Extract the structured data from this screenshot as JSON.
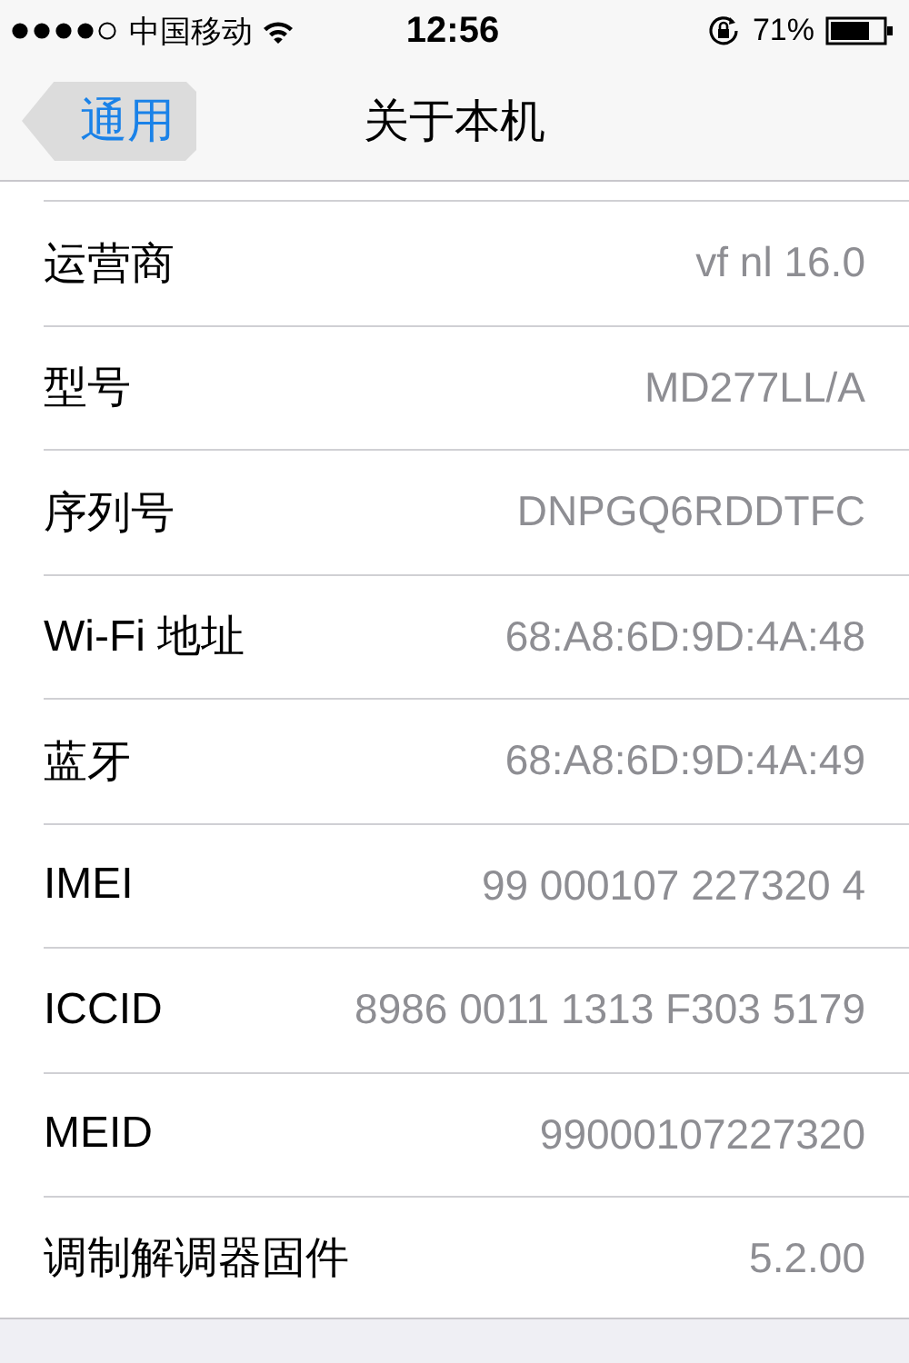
{
  "status_bar": {
    "carrier": "中国移动",
    "time": "12:56",
    "battery": "71%"
  },
  "nav_bar": {
    "back": "通用",
    "title": "关于本机"
  },
  "rows": [
    {
      "label": "运营商",
      "value": "vf nl 16.0"
    },
    {
      "label": "型号",
      "value": "MD277LL/A"
    },
    {
      "label": "序列号",
      "value": "DNPGQ6RDDTFC"
    },
    {
      "label": "Wi-Fi 地址",
      "value": "68:A8:6D:9D:4A:48"
    },
    {
      "label": "蓝牙",
      "value": "68:A8:6D:9D:4A:49"
    },
    {
      "label": "IMEI",
      "value": "99 000107 227320 4"
    },
    {
      "label": "ICCID",
      "value": "8986 0011 1313 F303 5179"
    },
    {
      "label": "MEID",
      "value": "99000107227320"
    },
    {
      "label": "调制解调器固件",
      "value": "5.2.00"
    }
  ]
}
